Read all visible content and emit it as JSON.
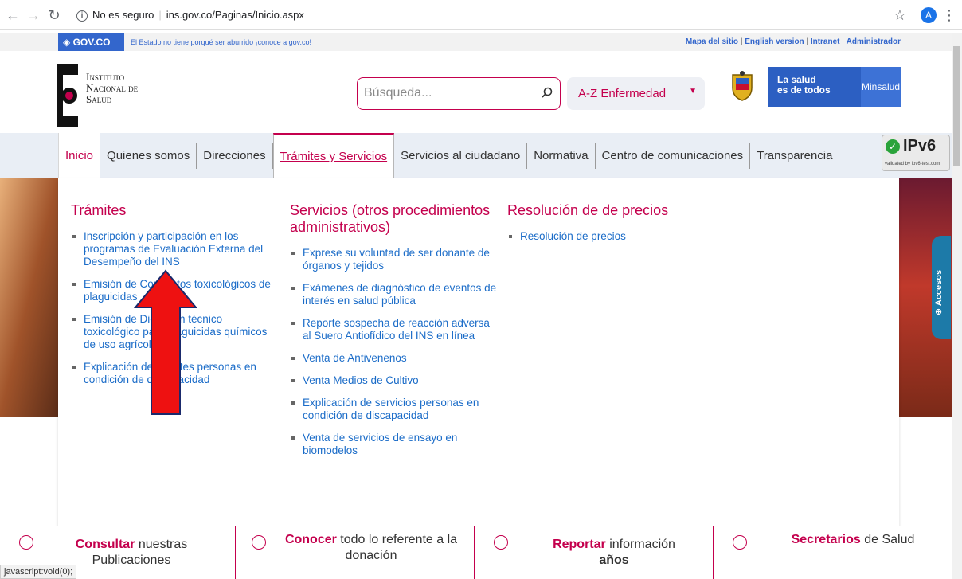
{
  "browser": {
    "security_label": "No es seguro",
    "url": "ins.gov.co/Paginas/Inicio.aspx",
    "profile_initial": "A",
    "status_text": "javascript:void(0);"
  },
  "govbar": {
    "logo": "GOV.CO",
    "tagline": "El Estado no tiene porqué ser aburrido ¡conoce a gov.co!",
    "links": [
      "Mapa del sitio",
      "English version",
      "Intranet",
      "Administrador"
    ]
  },
  "header": {
    "brand_lines": [
      "Instituto",
      "Nacional de",
      "Salud"
    ],
    "search_placeholder": "Búsqueda...",
    "az_select": "A-Z Enfermedad",
    "salud_slogan_1": "La salud",
    "salud_slogan_2": "es de todos",
    "minsalud": "Minsalud"
  },
  "nav": {
    "items": [
      "Inicio",
      "Quienes somos",
      "Direcciones",
      "Trámites y Servicios",
      "Servicios al ciudadano",
      "Normativa",
      "Centro de comunicaciones",
      "Transparencia"
    ],
    "ipv6": "IPv6",
    "ipv6_sub": "validated by ipv6-test.com"
  },
  "dropdown": {
    "col1": {
      "title": "Trámites",
      "items": [
        "Inscripción y participación en los programas de Evaluación Externa del Desempeño del INS",
        "Emisión de Conceptos toxicológicos de plaguicidas",
        "Emisión de Dictamen técnico toxicológico para plaguicidas químicos de uso agrícola",
        "Explicación de trámites personas en condición de discapacidad"
      ]
    },
    "col2": {
      "title": "Servicios (otros procedimientos administrativos)",
      "items": [
        "Exprese su voluntad de ser donante de órganos y tejidos",
        "Exámenes de diagnóstico de eventos de interés en salud pública",
        "Reporte sospecha de reacción adversa al Suero Antiofídico del INS en línea",
        "Venta de Antivenenos",
        "Venta Medios de Cultivo",
        "Explicación de servicios personas en condición de discapacidad",
        "Venta de servicios de ensayo en biomodelos"
      ]
    },
    "col3": {
      "title": "Resolución de de precios",
      "items": [
        "Resolución de precios"
      ]
    }
  },
  "side_tab": "Accesos",
  "cards": [
    {
      "strong": "Consultar",
      "rest": " nuestras",
      "line2": "Publicaciones"
    },
    {
      "strong": "Conocer",
      "rest": " todo lo referente a la",
      "line2": "donación"
    },
    {
      "strong": "Reportar",
      "rest": " información",
      "line2": "años"
    },
    {
      "strong": "Secretarios",
      "rest": " de Salud",
      "line2": ""
    }
  ],
  "colors": {
    "accent": "#c4004d",
    "link": "#1b6cc8",
    "gov_blue": "#3366cc"
  }
}
